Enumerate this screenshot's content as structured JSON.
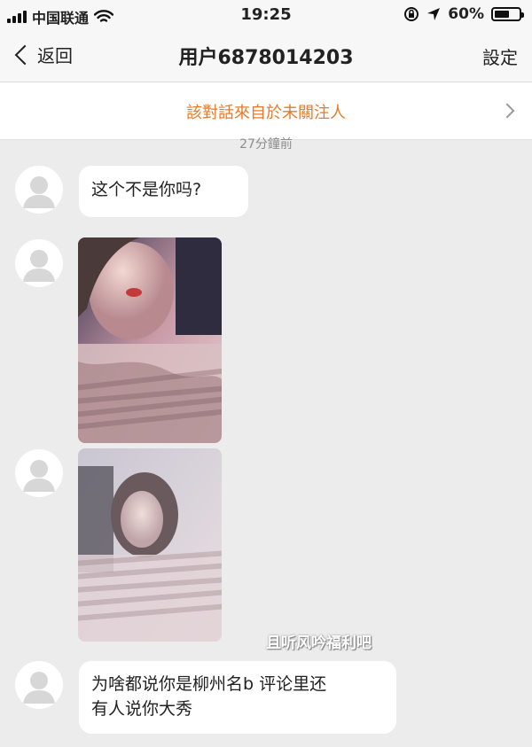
{
  "status_bar": {
    "carrier": "中国联通",
    "time": "19:25",
    "battery": "60%",
    "battery_level": 0.6,
    "icons": [
      "signal-icon",
      "wifi-icon",
      "orientation-lock-icon",
      "location-arrow-icon",
      "battery-icon"
    ]
  },
  "nav": {
    "back_label": "返回",
    "title": "用户6878014203",
    "settings_label": "設定"
  },
  "notice": {
    "text": "該對話來自於未關注人"
  },
  "timestamp": "27分鐘前",
  "messages": [
    {
      "type": "text",
      "text": "这个不是你吗?"
    },
    {
      "type": "image"
    },
    {
      "type": "image"
    },
    {
      "type": "text",
      "line1": "为啥都说你是柳州名b 评论里还",
      "line2": "有人说你大秀"
    }
  ],
  "watermark": "且听风吟福利吧",
  "colors": {
    "notice_text": "#e8792a",
    "background": "#ececec",
    "bubble": "#ffffff"
  }
}
